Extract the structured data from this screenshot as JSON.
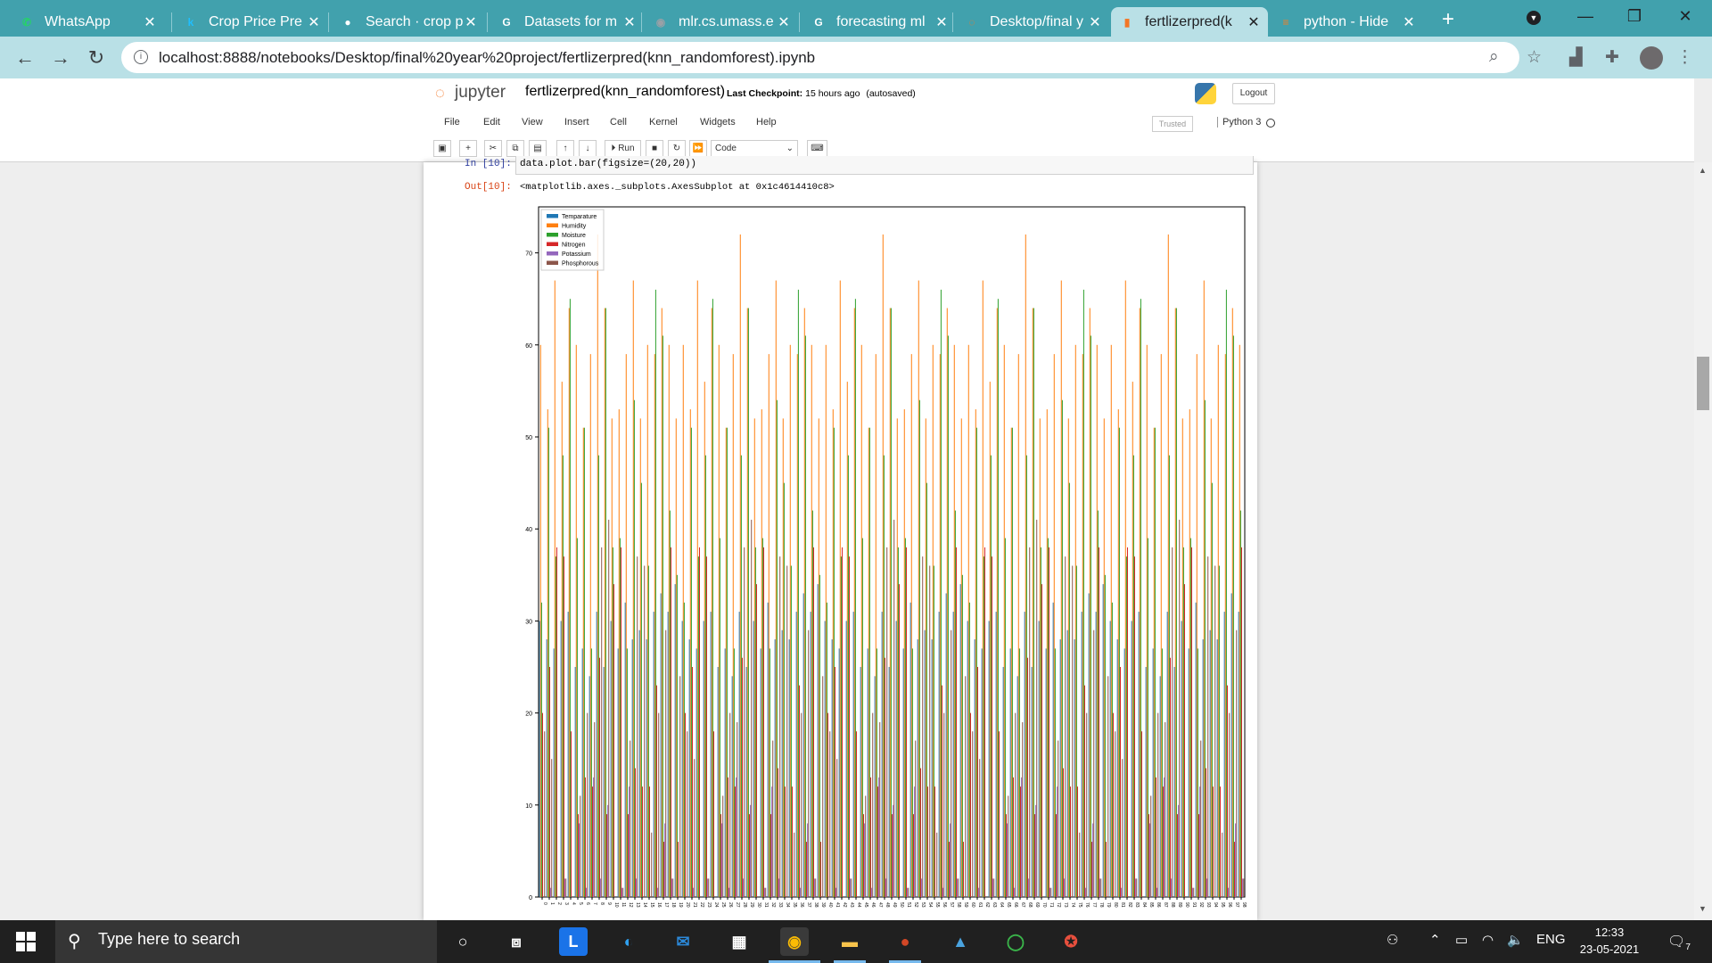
{
  "browser": {
    "tabs": [
      {
        "title": "WhatsApp",
        "icon": "whatsapp-icon",
        "color": "#25d366",
        "glyph": "✆"
      },
      {
        "title": "Crop Price Pre",
        "icon": "kaggle-icon",
        "color": "#20beff",
        "glyph": "k"
      },
      {
        "title": "Search · crop p",
        "icon": "github-icon",
        "color": "#ffffff",
        "glyph": "●"
      },
      {
        "title": "Datasets for m",
        "icon": "google-icon",
        "color": "#ffffff",
        "glyph": "G"
      },
      {
        "title": "mlr.cs.umass.e",
        "icon": "globe-icon",
        "color": "#9aa0a6",
        "glyph": "◉"
      },
      {
        "title": "forecasting ml",
        "icon": "google-icon",
        "color": "#ffffff",
        "glyph": "G"
      },
      {
        "title": "Desktop/final y",
        "icon": "jupyter-icon",
        "color": "#f37626",
        "glyph": "◌"
      },
      {
        "title": "fertlizerpred(k",
        "icon": "jupyter-notebook-icon",
        "color": "#f37626",
        "glyph": "▮"
      },
      {
        "title": "python - Hide",
        "icon": "stackoverflow-icon",
        "color": "#f48024",
        "glyph": "≡"
      }
    ],
    "url": "localhost:8888/notebooks/Desktop/final%20year%20project/fertlizerpred(knn_randomforest).ipynb"
  },
  "jupyter": {
    "logo_text": "jupyter",
    "notebook_name": "fertlizerpred(knn_randomforest)",
    "checkpoint_label": "Last Checkpoint:",
    "checkpoint_time": "15 hours ago",
    "autosave": "(autosaved)",
    "logout": "Logout",
    "menus": [
      "File",
      "Edit",
      "View",
      "Insert",
      "Cell",
      "Kernel",
      "Widgets",
      "Help"
    ],
    "trusted": "Trusted",
    "kernel": "Python 3",
    "toolbar_run": "Run",
    "cell_type": "Code"
  },
  "cell": {
    "in_prompt": "In [10]:",
    "code": "data.plot.bar(figsize=(20,20))",
    "out_prompt": "Out[10]:",
    "output": "<matplotlib.axes._subplots.AxesSubplot at 0x1c4614410c8>"
  },
  "chart_data": {
    "type": "bar",
    "categories_range": [
      0,
      98
    ],
    "ylim": [
      0,
      75
    ],
    "yticks": [
      0,
      10,
      20,
      30,
      40,
      50,
      60,
      70
    ],
    "legend_position": "top-left",
    "series": [
      {
        "name": "Temparature",
        "color": "#1f77b4"
      },
      {
        "name": "Humidity",
        "color": "#ff7f0e"
      },
      {
        "name": "Moisture",
        "color": "#2ca02c"
      },
      {
        "name": "Nitrogen",
        "color": "#d62728"
      },
      {
        "name": "Potassium",
        "color": "#9467bd"
      },
      {
        "name": "Phosphorous",
        "color": "#8c564b"
      }
    ],
    "sample_values": {
      "Temparature": [
        26,
        29,
        34,
        32,
        28,
        26,
        25,
        33,
        30,
        29,
        27,
        31,
        25,
        32,
        26,
        30,
        34,
        28,
        27,
        29
      ],
      "Humidity": [
        52,
        52,
        65,
        62,
        54,
        50,
        64,
        60,
        62,
        58,
        52,
        64,
        60,
        54,
        65,
        58,
        52,
        68,
        62,
        70
      ],
      "Moisture": [
        38,
        45,
        62,
        34,
        46,
        50,
        64,
        28,
        38,
        40,
        50,
        65,
        28,
        40,
        52,
        65,
        35,
        38,
        41,
        46
      ],
      "Nitrogen": [
        37,
        12,
        7,
        22,
        35,
        12,
        9,
        10,
        14,
        36,
        24,
        18,
        13,
        36,
        12,
        22,
        6,
        39,
        11,
        24
      ],
      "Potassium": [
        0,
        0,
        9,
        0,
        0,
        0,
        10,
        13,
        0,
        0,
        0,
        0,
        14,
        0,
        0,
        0,
        0,
        0,
        10,
        0
      ],
      "Phosphorous": [
        0,
        36,
        30,
        20,
        0,
        19,
        41,
        18,
        9,
        0,
        14,
        0,
        20,
        0,
        35,
        19,
        24,
        0,
        13,
        36
      ]
    }
  },
  "taskbar": {
    "search_placeholder": "Type here to search",
    "language": "ENG",
    "time": "12:33",
    "date": "23-05-2021",
    "notifications": "7"
  }
}
